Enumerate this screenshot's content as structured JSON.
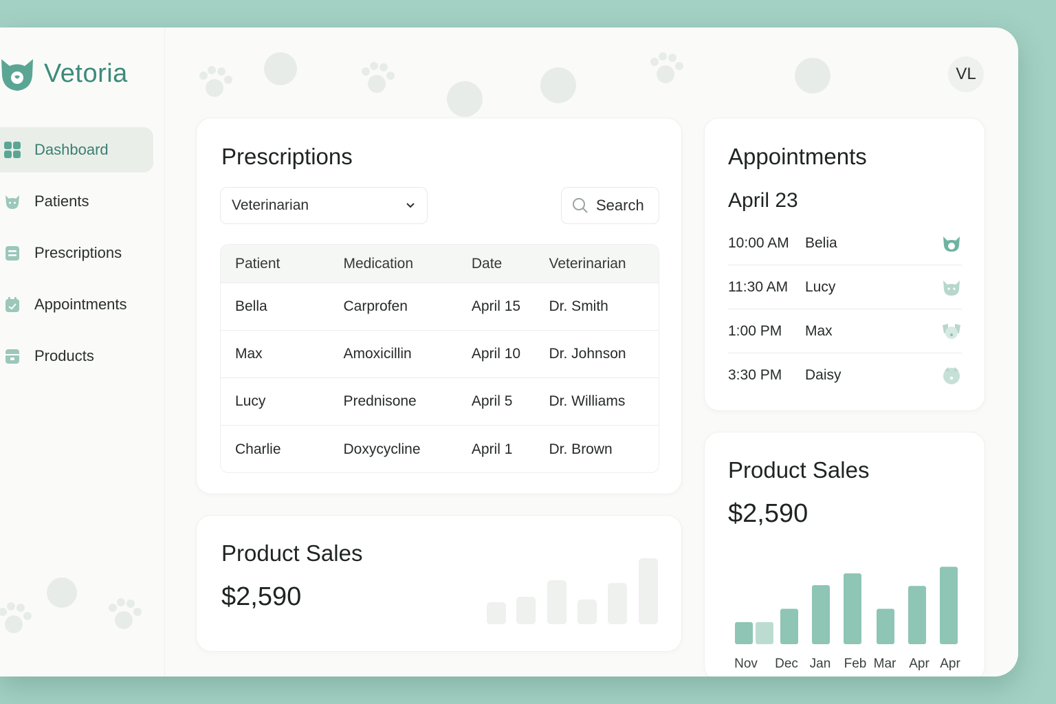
{
  "brand": {
    "name": "Vetoria"
  },
  "user": {
    "initials": "VL"
  },
  "sidebar": {
    "items": [
      {
        "label": "Dashboard",
        "active": true,
        "icon": "dashboard-icon"
      },
      {
        "label": "Patients",
        "active": false,
        "icon": "cat-icon"
      },
      {
        "label": "Prescriptions",
        "active": false,
        "icon": "prescription-icon"
      },
      {
        "label": "Appointments",
        "active": false,
        "icon": "calendar-icon"
      },
      {
        "label": "Products",
        "active": false,
        "icon": "product-box-icon"
      }
    ]
  },
  "prescriptions": {
    "title": "Prescriptions",
    "filter": {
      "selected": "Veterinarian"
    },
    "search": {
      "label": "Search"
    },
    "columns": [
      "Patient",
      "Medication",
      "Date",
      "Veterinarian"
    ],
    "rows": [
      [
        "Bella",
        "Carprofen",
        "April 15",
        "Dr. Smith"
      ],
      [
        "Max",
        "Amoxicillin",
        "April 10",
        "Dr. Johnson"
      ],
      [
        "Lucy",
        "Prednisone",
        "April 5",
        "Dr. Williams"
      ],
      [
        "Charlie",
        "Doxycycline",
        "April 1",
        "Dr. Brown"
      ]
    ]
  },
  "product_sales_small": {
    "title": "Product Sales",
    "amount": "$2,590"
  },
  "appointments": {
    "title": "Appointments",
    "date": "April 23",
    "items": [
      {
        "time": "10:00 AM",
        "name": "Belia",
        "icon": "cat-face-icon"
      },
      {
        "time": "11:30 AM",
        "name": "Lucy",
        "icon": "cat-face-icon"
      },
      {
        "time": "1:00 PM",
        "name": "Max",
        "icon": "dog-face-icon"
      },
      {
        "time": "3:30 PM",
        "name": "Daisy",
        "icon": "dog-face-icon"
      }
    ]
  },
  "product_sales": {
    "title": "Product Sales",
    "amount": "$2,590"
  },
  "colors": {
    "accent": "#3d8a7b",
    "bar": "#8ec5b5",
    "bar_light": "#bcdcd1",
    "background": "#a3d1c4"
  },
  "chart_data": {
    "type": "bar",
    "categories": [
      "Nov",
      "Dec",
      "Jan",
      "Feb",
      "Mar",
      "Apr",
      "Apr"
    ],
    "series": [
      {
        "values": [
          30,
          30
        ]
      },
      {
        "values": [
          48,
          80,
          96,
          48,
          79,
          105
        ]
      }
    ],
    "bars": [
      {
        "category": "Nov",
        "value": 30
      },
      {
        "category": "Nov",
        "value": 30,
        "light": true
      },
      {
        "category": "Dec",
        "value": 48
      },
      {
        "category": "Jan",
        "value": 80
      },
      {
        "category": "Feb",
        "value": 96
      },
      {
        "category": "Mar",
        "value": 48
      },
      {
        "category": "Apr",
        "value": 79
      },
      {
        "category": "Apr",
        "value": 105
      }
    ],
    "ylim": [
      0,
      110
    ],
    "grid": false,
    "title": "",
    "xlabel": "",
    "ylabel": ""
  }
}
